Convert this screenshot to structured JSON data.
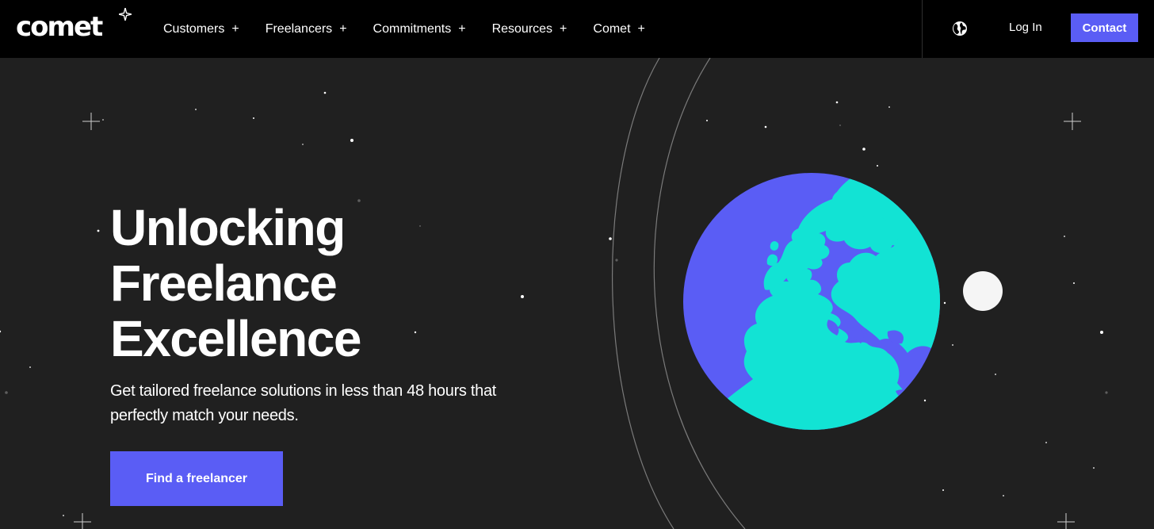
{
  "brand": {
    "logo_text": "comet",
    "logo_icon": "sparkle-icon"
  },
  "nav": {
    "items": [
      {
        "label": "Customers",
        "suffix": "+"
      },
      {
        "label": "Freelancers",
        "suffix": "+"
      },
      {
        "label": "Commitments",
        "suffix": "+"
      },
      {
        "label": "Resources",
        "suffix": "+"
      },
      {
        "label": "Comet",
        "suffix": "+"
      }
    ],
    "globe_icon": "globe-icon",
    "login_label": "Log In",
    "contact_label": "Contact"
  },
  "hero": {
    "title_lines": [
      "Unlocking",
      "Freelance",
      "Excellence"
    ],
    "subtitle": "Get tailored freelance solutions in less than 48 hours that perfectly match your needs.",
    "cta_label": "Find a freelancer"
  },
  "colors": {
    "background": "#202020",
    "topbar": "#000000",
    "accent": "#5a5df5",
    "earth_ocean": "#5a5df5",
    "earth_land": "#12e3d4",
    "moon": "#f5f5f5"
  }
}
